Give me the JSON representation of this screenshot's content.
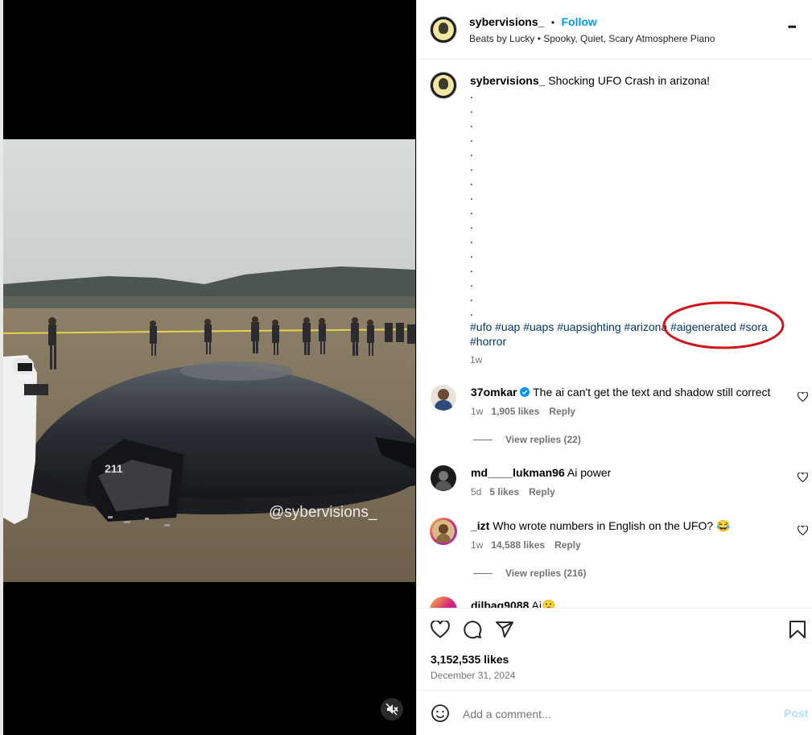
{
  "post": {
    "username": "sybervisions_",
    "follow_label": "Follow",
    "separator": "•",
    "audio": "Beats by Lucky • Spooky, Quiet, Scary Atmosphere Piano",
    "more_label": "•••",
    "watermark": "@sybervisions_"
  },
  "caption": {
    "username": "sybervisions_",
    "text": "Shocking UFO Crash in arizona!",
    "dots": ".",
    "hashtags_line1": [
      "#ufo",
      "#uap",
      "#uaps",
      "#uapsighting",
      "#arizona",
      "#aigenerated",
      "#sora"
    ],
    "hashtags_line2": "#horror",
    "time": "1w"
  },
  "comments": [
    {
      "username": "37omkar",
      "verified": true,
      "text": "The ai can't get the text and shadow still correct",
      "time": "1w",
      "likes": "1,905 likes",
      "reply": "Reply",
      "view_replies": "View replies (22)"
    },
    {
      "username": "md____lukman96",
      "text": "Ai power",
      "time": "5d",
      "likes": "5 likes",
      "reply": "Reply"
    },
    {
      "username": "_izt",
      "text": "Who wrote numbers in English on the UFO? 😂",
      "time": "1w",
      "likes": "14,588 likes",
      "reply": "Reply",
      "view_replies": "View replies (216)"
    },
    {
      "username": "dilbag9088",
      "text": "Ai😕"
    }
  ],
  "stats": {
    "likes": "3,152,535 likes",
    "date": "December 31, 2024"
  },
  "composer": {
    "placeholder": "Add a comment...",
    "post_label": "Post"
  },
  "colors": {
    "link": "#0095f6",
    "hashtag": "#00376b",
    "annotation": "#d0151c"
  }
}
